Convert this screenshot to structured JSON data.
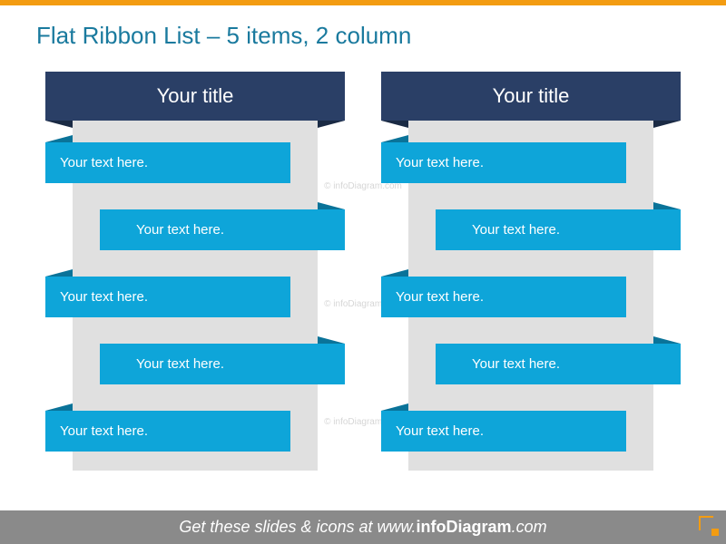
{
  "title": "Flat Ribbon List – 5 items, 2 column",
  "watermark": "© infoDiagram.com",
  "columns": [
    {
      "header": "Your title",
      "items": [
        "Your text here.",
        "Your text here.",
        "Your text here.",
        "Your text here.",
        "Your text here."
      ]
    },
    {
      "header": "Your title",
      "items": [
        "Your text here.",
        "Your text here.",
        "Your text here.",
        "Your text here.",
        "Your text here."
      ]
    }
  ],
  "footer": {
    "prefix": "Get these slides & icons at www.",
    "bold": "infoDiagram",
    "suffix": ".com"
  }
}
